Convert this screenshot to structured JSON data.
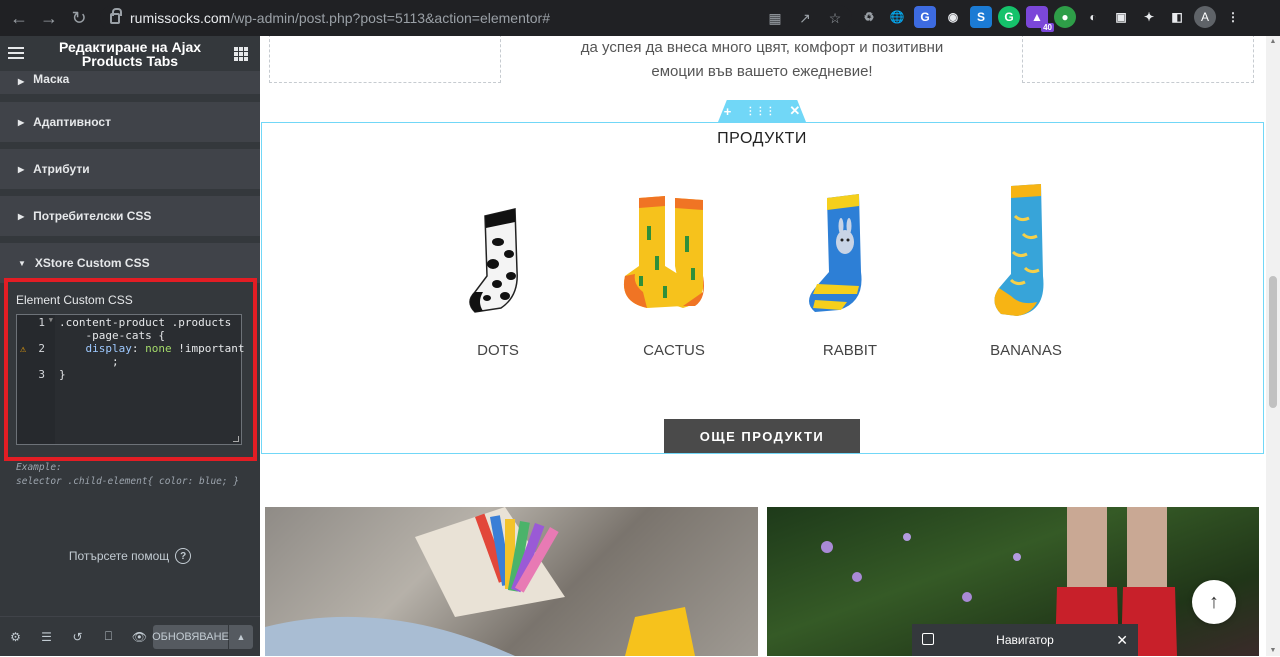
{
  "browser": {
    "url_host": "rumissocks.com",
    "url_path": "/wp-admin/post.php?post=5113&action=elementor#",
    "extension_badge": "40",
    "avatar_letter": "A"
  },
  "panel": {
    "title": "Редактиране на Ajax Products Tabs",
    "sections": [
      {
        "label": "Маска"
      },
      {
        "label": "Адаптивност"
      },
      {
        "label": "Атрибути"
      },
      {
        "label": "Потребителски CSS"
      },
      {
        "label": "XStore Custom CSS"
      }
    ],
    "custom_css": {
      "label": "Element Custom CSS",
      "line_numbers": [
        "1",
        "2",
        "3"
      ],
      "code_line1": ".content-product .products",
      "code_line1b": "    -page-cats {",
      "code_prop": "display",
      "code_val": "none",
      "code_important": "!important",
      "code_semicolon": ";",
      "code_close": "}"
    },
    "example_line1": "Example:",
    "example_line2": "selector .child-element{ color: blue; }",
    "help_text": "Потърсете помощ",
    "publish_label": "ОБНОВЯВАНЕ"
  },
  "page": {
    "intro_line1": "да успея да внеса много цвят, комфорт и позитивни",
    "intro_line2": "емоции във вашето ежедневие!",
    "products_title": "ПРОДУКТИ",
    "products": [
      {
        "name": "DOTS"
      },
      {
        "name": "CACTUS"
      },
      {
        "name": "RABBIT"
      },
      {
        "name": "BANANAS"
      }
    ],
    "more_button": "ОЩЕ ПРОДУКТИ"
  },
  "navigator": {
    "title": "Навигатор"
  },
  "colors": {
    "panel_bg": "#34383c",
    "highlight": "#e31d24",
    "selection": "#71d7f7"
  }
}
